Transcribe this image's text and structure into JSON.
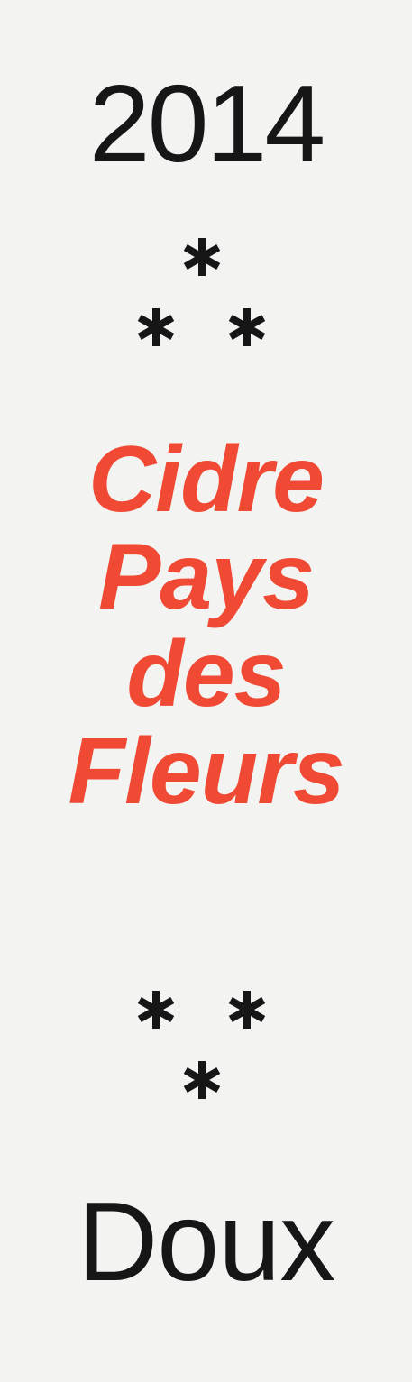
{
  "label": {
    "year": "2014",
    "title_lines": [
      "Cidre",
      "Pays",
      "des",
      "Fleurs"
    ],
    "sweetness": "Doux",
    "ornament_icon": "asterisk-icon"
  },
  "colors": {
    "background": "#f3f3f2",
    "text": "#161616",
    "accent": "#f04a34"
  }
}
